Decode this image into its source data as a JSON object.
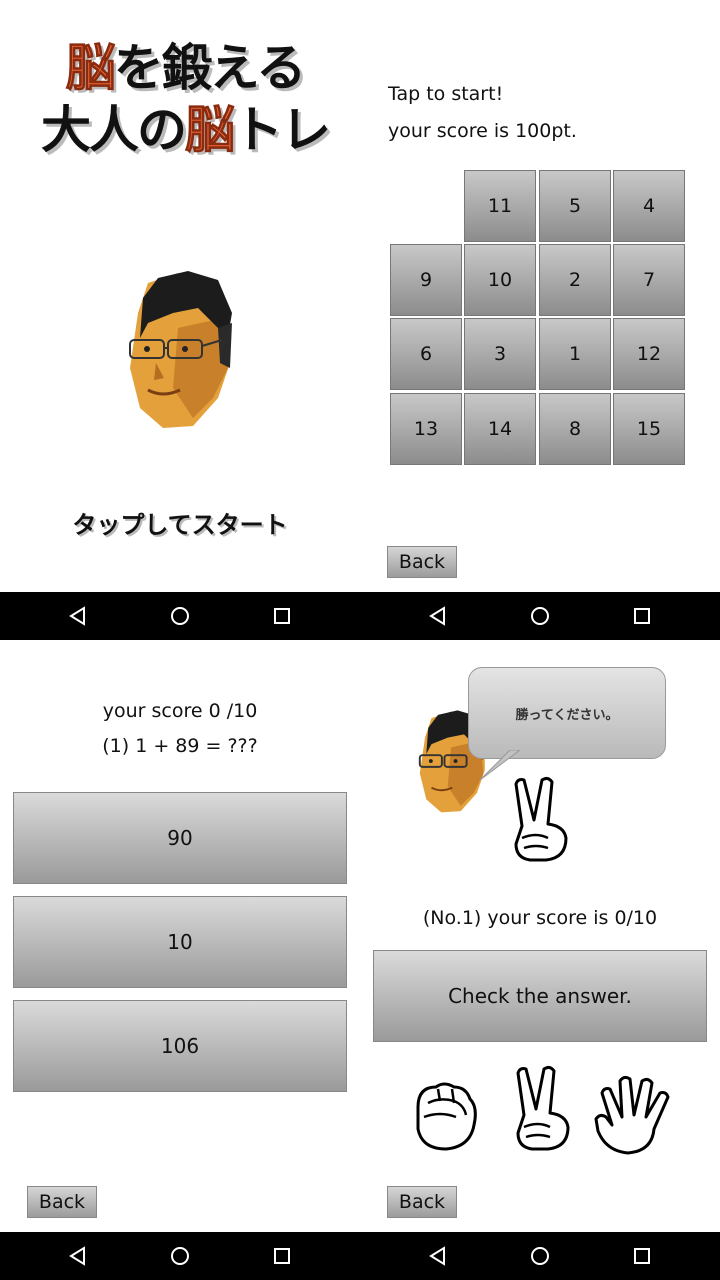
{
  "title_screen": {
    "title_line1_a": "脳",
    "title_line1_b": "を鍛える",
    "title_line2_a": "大人の",
    "title_line2_b": "脳",
    "title_line2_c": "トレ",
    "tap_to_start": "タップしてスタート",
    "accent_color": "#ef6a3a"
  },
  "puzzle_screen": {
    "tap_to_start": "Tap to start!",
    "score_text": "your score is 100pt.",
    "tiles": [
      "",
      "11",
      "5",
      "4",
      "9",
      "10",
      "2",
      "7",
      "6",
      "3",
      "1",
      "12",
      "13",
      "14",
      "8",
      "15"
    ],
    "back_label": "Back"
  },
  "quiz_screen": {
    "score_text": "your score 0 /10",
    "question": "(1)   1 +  89 = ???",
    "answers": [
      "90",
      "10",
      "106"
    ],
    "back_label": "Back"
  },
  "janken_screen": {
    "speech": "勝ってください。",
    "score_text": "(No.1) your score is 0/10",
    "check_label": "Check the answer.",
    "hands": [
      "rock-hand-icon",
      "scissors-hand-icon",
      "paper-hand-icon"
    ],
    "back_label": "Back"
  },
  "navbar": {
    "icons": [
      "back-triangle-icon",
      "home-circle-icon",
      "recents-square-icon"
    ]
  }
}
